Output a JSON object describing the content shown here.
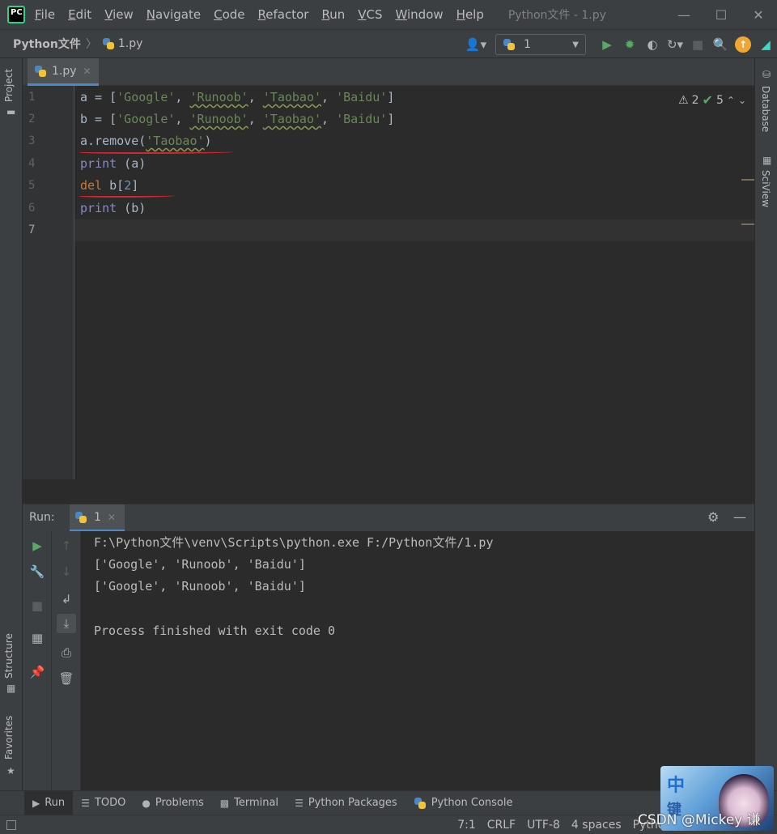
{
  "app": {
    "logo_text": "PC",
    "window_title": "Python文件 - 1.py",
    "menu": [
      "File",
      "Edit",
      "View",
      "Navigate",
      "Code",
      "Refactor",
      "Run",
      "VCS",
      "Window",
      "Help"
    ]
  },
  "navbar": {
    "project": "Python文件",
    "file": "1.py",
    "run_config": "1"
  },
  "left_strip": {
    "project_label": "Project",
    "structure_label": "Structure",
    "favorites_label": "Favorites"
  },
  "right_strip": {
    "database_label": "Database",
    "sciview_label": "SciView"
  },
  "editor": {
    "tab_label": "1.py",
    "warnings": "2",
    "ok_count": "5",
    "line_numbers": [
      "1",
      "2",
      "3",
      "4",
      "5",
      "6",
      "7"
    ],
    "lines": {
      "l1": {
        "pre": "a = [",
        "items": [
          "'Google'",
          "'Runoob'",
          "'Taobao'",
          "'Baidu'"
        ],
        "close": "]"
      },
      "l2": {
        "pre": "b = [",
        "items": [
          "'Google'",
          "'Runoob'",
          "'Taobao'",
          "'Baidu'"
        ],
        "close": "]"
      },
      "l3": {
        "obj": "a.remove(",
        "arg": "'Taobao'",
        "close": ")"
      },
      "l4": {
        "fn": "print",
        "rest": " (a)"
      },
      "l5": {
        "kw": "del",
        "pre": " b[",
        "num": "2",
        "close": "]"
      },
      "l6": {
        "fn": "print",
        "rest": " (b)"
      }
    }
  },
  "run": {
    "title": "Run:",
    "tab_label": "1",
    "console": [
      "F:\\Python文件\\venv\\Scripts\\python.exe F:/Python文件/1.py",
      "['Google', 'Runoob', 'Baidu']",
      "['Google', 'Runoob', 'Baidu']",
      "",
      "Process finished with exit code 0"
    ]
  },
  "bottom_tools": [
    "Run",
    "TODO",
    "Problems",
    "Terminal",
    "Python Packages",
    "Python Console"
  ],
  "status": {
    "position": "7:1",
    "line_sep": "CRLF",
    "encoding": "UTF-8",
    "indent": "4 spaces",
    "interpreter": "Python 3."
  },
  "watermark": {
    "text": "CSDN @Mickey 谦",
    "avatar_chars": [
      "中",
      "键"
    ]
  }
}
